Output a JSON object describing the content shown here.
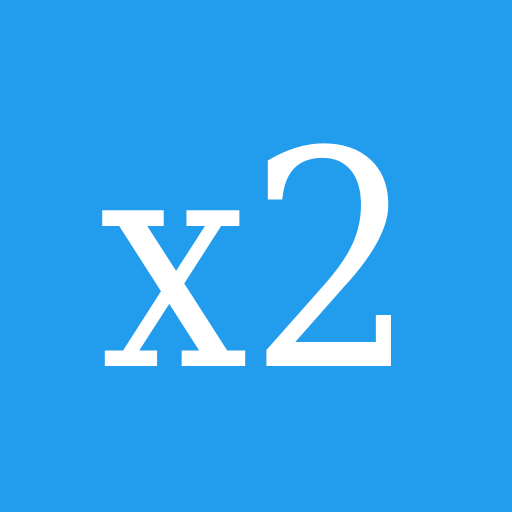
{
  "icon": {
    "name": "x2-icon",
    "text": "x2",
    "background_color": "#229ced",
    "foreground_color": "#ffffff"
  }
}
